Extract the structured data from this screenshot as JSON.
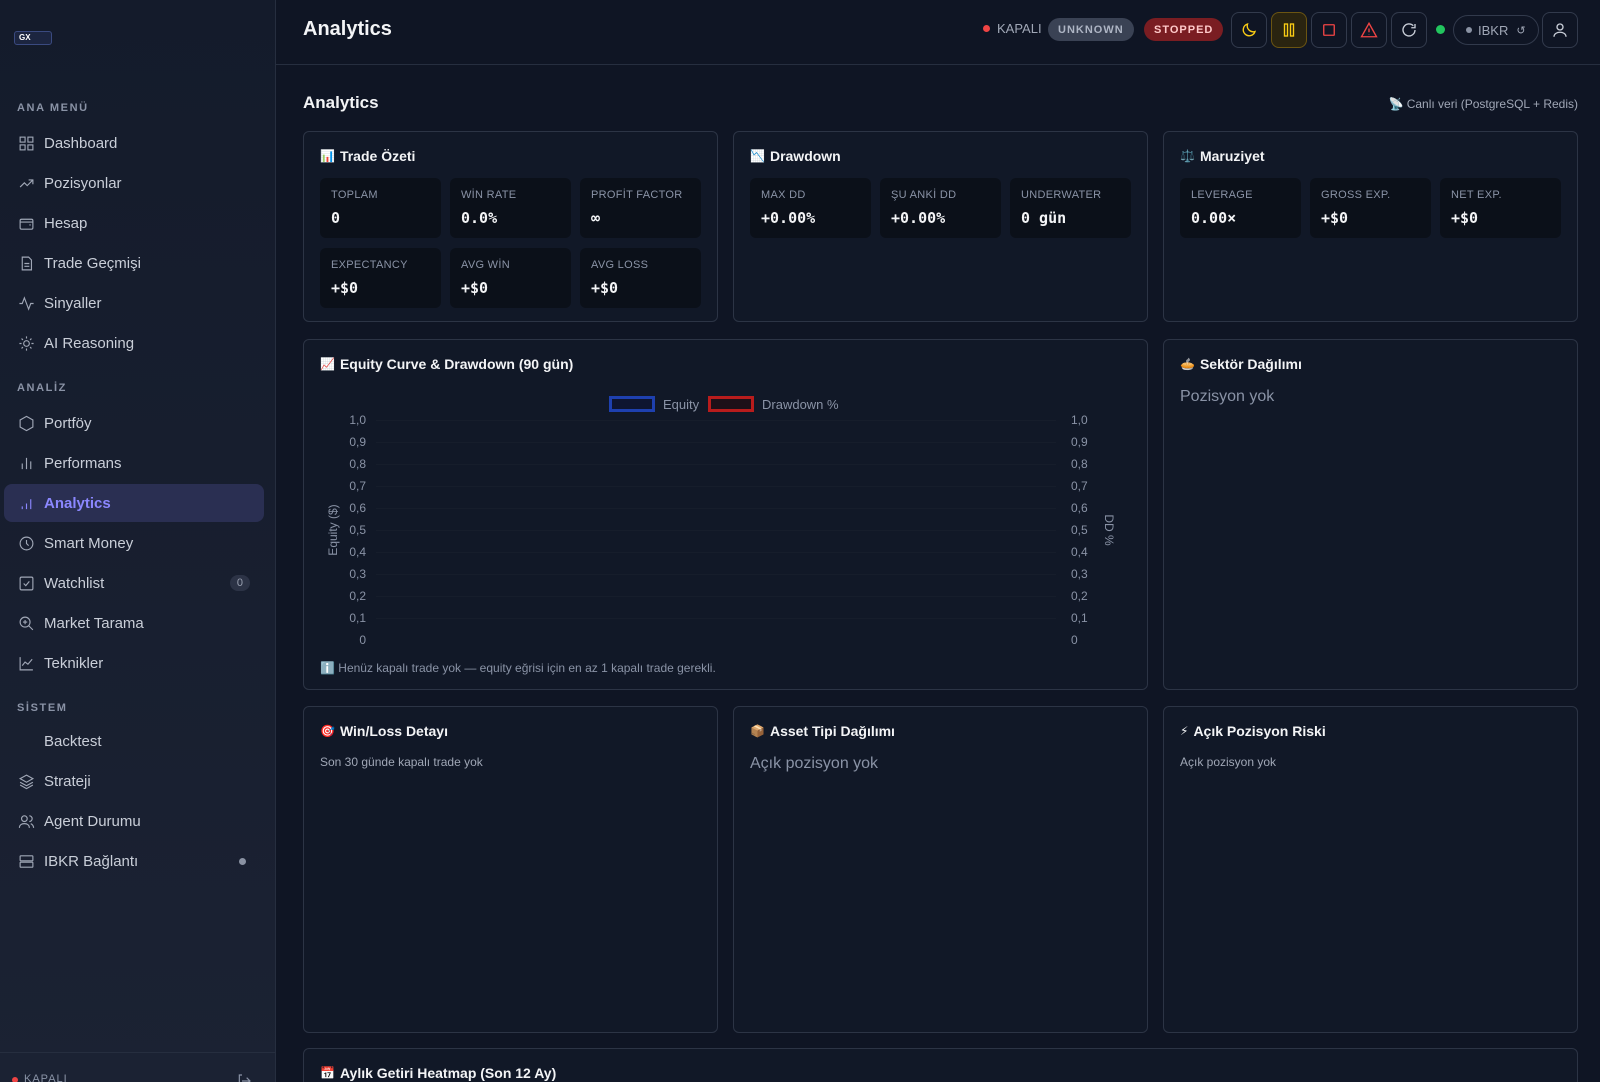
{
  "app": {
    "logo_text": "GX"
  },
  "sidebar": {
    "sections": [
      {
        "label": "ANA MENÜ"
      },
      {
        "label": "ANALİZ"
      },
      {
        "label": "SİSTEM"
      }
    ],
    "items": [
      {
        "label": "Dashboard",
        "icon": "grid-icon"
      },
      {
        "label": "Pozisyonlar",
        "icon": "trend-up-icon"
      },
      {
        "label": "Hesap",
        "icon": "wallet-icon"
      },
      {
        "label": "Trade Geçmişi",
        "icon": "file-icon"
      },
      {
        "label": "Sinyaller",
        "icon": "activity-icon"
      },
      {
        "label": "AI Reasoning",
        "icon": "sun-icon"
      },
      {
        "label": "Portföy",
        "icon": "hexagon-icon"
      },
      {
        "label": "Performans",
        "icon": "bar-chart-icon"
      },
      {
        "label": "Analytics",
        "icon": "analytics-icon",
        "active": true
      },
      {
        "label": "Smart Money",
        "icon": "clock-icon"
      },
      {
        "label": "Watchlist",
        "icon": "check-square-icon",
        "badge": "0"
      },
      {
        "label": "Market Tarama",
        "icon": "search-plus-icon"
      },
      {
        "label": "Teknikler",
        "icon": "line-chart-icon"
      },
      {
        "label": "Backtest",
        "icon": ""
      },
      {
        "label": "Strateji",
        "icon": "layers-icon"
      },
      {
        "label": "Agent Durumu",
        "icon": "users-icon"
      },
      {
        "label": "IBKR Bağlantı",
        "icon": "server-icon"
      }
    ],
    "footer_status": "KAPALI"
  },
  "topbar": {
    "title": "Analytics",
    "market_status": "KAPALI",
    "pill_unknown": "UNKNOWN",
    "pill_stopped": "STOPPED",
    "broker": "IBKR",
    "broker_refresh": "↺"
  },
  "content": {
    "title": "Analytics",
    "live_note": "📡 Canlı veri (PostgreSQL + Redis)"
  },
  "trade_summary": {
    "title": "Trade Özeti",
    "emoji": "📊",
    "stats": [
      {
        "label": "TOPLAM",
        "value": "0"
      },
      {
        "label": "WİN RATE",
        "value": "0.0%"
      },
      {
        "label": "PROFİT FACTOR",
        "value": "∞"
      },
      {
        "label": "EXPECTANCY",
        "value": "+$0"
      },
      {
        "label": "AVG WİN",
        "value": "+$0"
      },
      {
        "label": "AVG LOSS",
        "value": "+$0"
      }
    ]
  },
  "drawdown": {
    "title": "Drawdown",
    "emoji": "📉",
    "stats": [
      {
        "label": "MAX DD",
        "value": "+0.00%"
      },
      {
        "label": "ŞU ANKİ DD",
        "value": "+0.00%"
      },
      {
        "label": "UNDERWATER",
        "value": "0 gün"
      }
    ]
  },
  "exposure": {
    "title": "Maruziyet",
    "emoji": "⚖️",
    "stats": [
      {
        "label": "LEVERAGE",
        "value": "0.00×"
      },
      {
        "label": "GROSS EXP.",
        "value": "+$0"
      },
      {
        "label": "NET EXP.",
        "value": "+$0"
      }
    ]
  },
  "equity_card": {
    "title": "Equity Curve & Drawdown (90 gün)",
    "emoji": "📈",
    "note": "ℹ️ Henüz kapalı trade yok — equity eğrisi için en az 1 kapalı trade gerekli."
  },
  "chart_data": {
    "type": "line",
    "series": [
      {
        "name": "Equity",
        "color": "#1e40af",
        "values": []
      },
      {
        "name": "Drawdown %",
        "color": "#b91c1c",
        "values": []
      }
    ],
    "x": [],
    "ylabel": "Equity ($)",
    "y2label": "DD %",
    "ylim": [
      0,
      1
    ],
    "y2lim": [
      0,
      1
    ],
    "yticks": [
      "1,0",
      "0,9",
      "0,8",
      "0,7",
      "0,6",
      "0,5",
      "0,4",
      "0,3",
      "0,2",
      "0,1",
      "0"
    ],
    "y2ticks": [
      "1,0",
      "0,9",
      "0,8",
      "0,7",
      "0,6",
      "0,5",
      "0,4",
      "0,3",
      "0,2",
      "0,1",
      "0"
    ],
    "legend": "top-center"
  },
  "sector": {
    "title": "Sektör Dağılımı",
    "emoji": "🥧",
    "empty": "Pozisyon yok"
  },
  "winloss": {
    "title": "Win/Loss Detayı",
    "emoji": "🎯",
    "empty": "Son 30 günde kapalı trade yok"
  },
  "asset": {
    "title": "Asset Tipi Dağılımı",
    "emoji": "📦",
    "empty": "Açık pozisyon yok"
  },
  "risk": {
    "title": "Açık Pozisyon Riski",
    "emoji": "⚡",
    "empty": "Açık pozisyon yok"
  },
  "heatmap": {
    "title": "Aylık Getiri Heatmap (Son 12 Ay)",
    "emoji": "📅"
  }
}
